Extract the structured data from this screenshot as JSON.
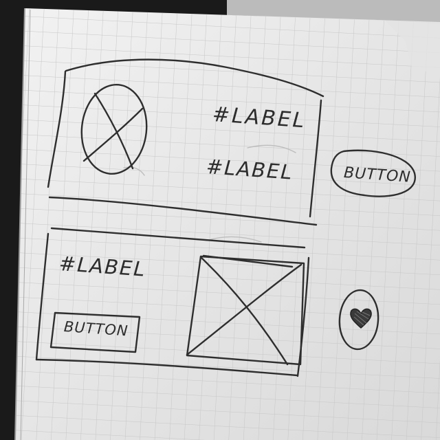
{
  "card_top": {
    "label_primary": "#LABEL",
    "label_secondary": "#LABEL"
  },
  "side_button": {
    "label": "BUTTON"
  },
  "card_bottom": {
    "label": "#LABEL",
    "button_label": "BUTTON"
  },
  "icons": {
    "avatar": "image-placeholder-icon",
    "image": "image-placeholder-icon",
    "favorite": "heart-icon"
  },
  "colors": {
    "paper": "#e9e9e9",
    "grid": "#c4c4c4",
    "ink": "#2e2e2e"
  }
}
